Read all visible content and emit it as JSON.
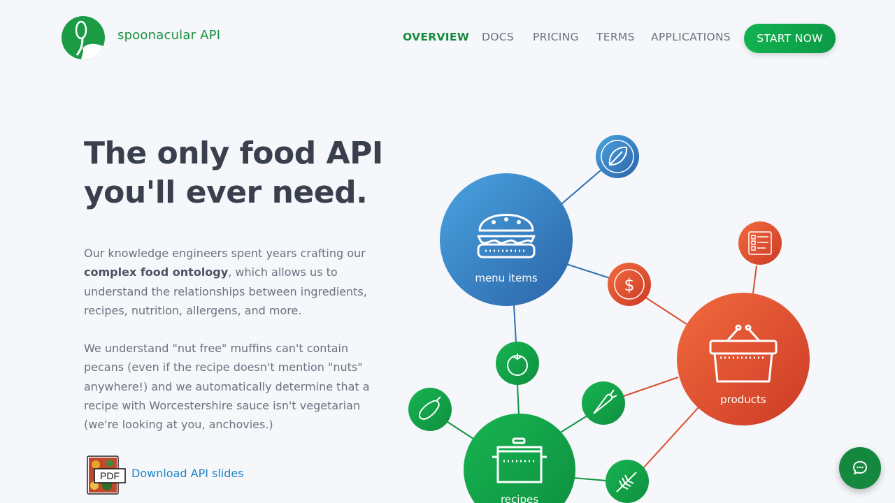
{
  "header": {
    "brand": "spoonacular API",
    "nav": [
      {
        "label": "OVERVIEW",
        "active": true
      },
      {
        "label": "DOCS",
        "active": false
      },
      {
        "label": "PRICING",
        "active": false
      },
      {
        "label": "TERMS",
        "active": false
      },
      {
        "label": "APPLICATIONS",
        "active": false
      }
    ],
    "cta": "START NOW"
  },
  "hero": {
    "headline_line1": "The only food API",
    "headline_line2": "you'll ever need.",
    "para1_before": "Our knowledge engineers spent years crafting our ",
    "para1_bold": "complex food ontology",
    "para1_after": ", which allows us to understand the relationships between ingredients, recipes, nutrition, allergens, and more.",
    "para2": "We understand \"nut free\" muffins can't contain pecans (even if the recipe doesn't mention \"nuts\" anywhere!) and we automatically determine that a recipe with Worcestershire sauce isn't vegetarian (we're looking at you, anchovies.)",
    "pdf_badge": "PDF",
    "download_link": "Download API slides"
  },
  "graph": {
    "menu_items_label": "menu items",
    "products_label": "products",
    "recipes_label": "recipes",
    "colors": {
      "blue": "#2f7fc1",
      "red": "#e0502e",
      "green": "#14a04a"
    }
  },
  "icons": [
    "leaf-icon",
    "burger-icon",
    "dollar-icon",
    "checklist-icon",
    "basket-icon",
    "tomato-icon",
    "eggplant-icon",
    "carrot-icon",
    "pot-icon",
    "wheat-icon",
    "chat-icon"
  ]
}
